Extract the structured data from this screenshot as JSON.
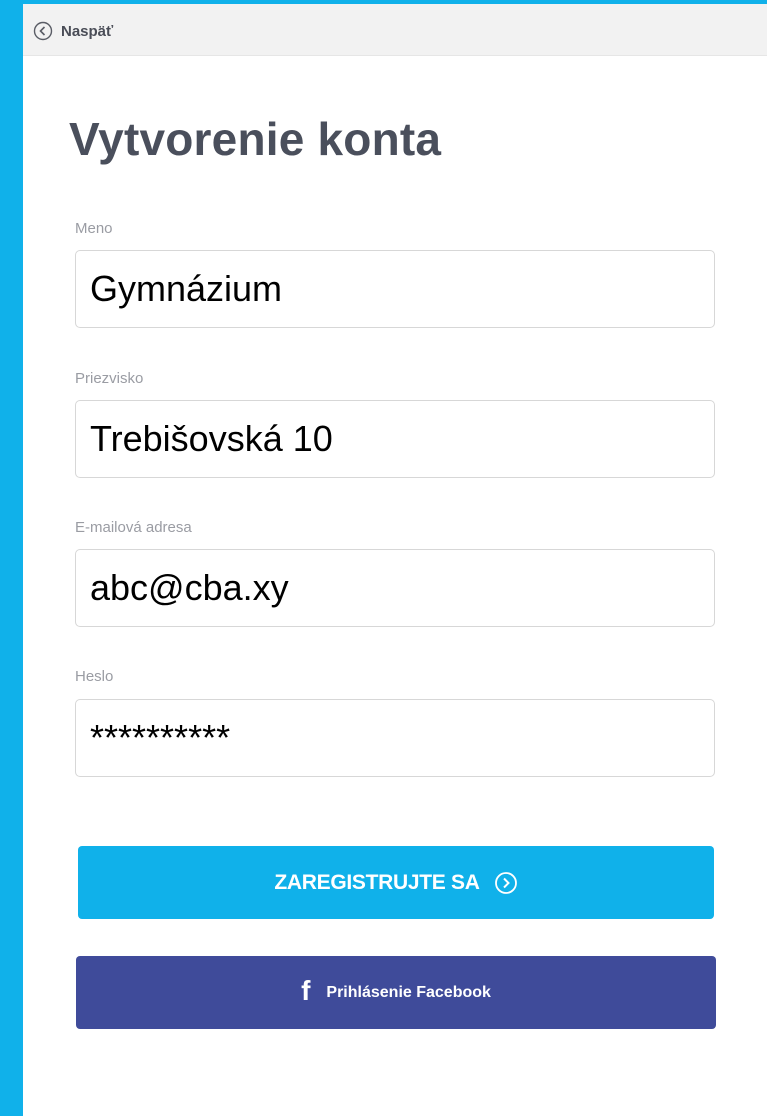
{
  "header": {
    "back_label": "Naspäť",
    "back_icon": "chevron-left-circle-icon"
  },
  "page": {
    "title": "Vytvorenie konta"
  },
  "form": {
    "first_name": {
      "label": "Meno",
      "value": "Gymnázium"
    },
    "last_name": {
      "label": "Priezvisko",
      "value": "Trebišovská 10"
    },
    "email": {
      "label": "E-mailová adresa",
      "value": "abc@cba.xy"
    },
    "password": {
      "label": "Heslo",
      "value": "**********"
    }
  },
  "actions": {
    "register_label": "ZAREGISTRUJTE SA",
    "register_icon": "chevron-right-circle-icon",
    "facebook_label": "Prihlásenie Facebook",
    "facebook_icon": "f"
  },
  "colors": {
    "accent": "#10b1ea",
    "facebook": "#3f4b9a",
    "title": "#4a4f5c",
    "label": "#9a9ca3"
  }
}
